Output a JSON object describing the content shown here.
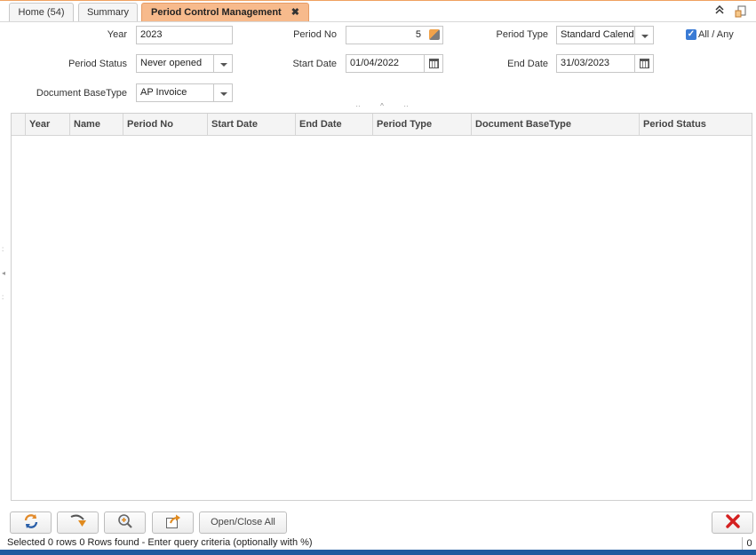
{
  "tabs": [
    {
      "label": "Home (54)"
    },
    {
      "label": "Summary"
    },
    {
      "label": "Period Control Management",
      "close": "✖"
    }
  ],
  "form": {
    "year": {
      "label": "Year",
      "value": "2023"
    },
    "period_no": {
      "label": "Period No",
      "value": "5"
    },
    "period_type": {
      "label": "Period Type",
      "value": "Standard Calend"
    },
    "all_any": {
      "label": "All / Any",
      "checked": true
    },
    "period_status": {
      "label": "Period Status",
      "value": "Never opened"
    },
    "start_date": {
      "label": "Start Date",
      "value": "01/04/2022"
    },
    "end_date": {
      "label": "End Date",
      "value": "31/03/2023"
    },
    "doc_base_type": {
      "label": "Document BaseType",
      "value": "AP Invoice"
    }
  },
  "grid": {
    "columns": [
      "Year",
      "Name",
      "Period No",
      "Start Date",
      "End Date",
      "Period Type",
      "Document BaseType",
      "Period Status"
    ],
    "rows": []
  },
  "toolbar": {
    "refresh_icon": "refresh-icon",
    "dropdown_icon": "down-arrow-icon",
    "zoom_icon": "zoom-icon",
    "export_icon": "export-icon",
    "open_close_label": "Open/Close All",
    "cancel_icon": "cancel-icon"
  },
  "status": {
    "text": "Selected 0 rows  0 Rows found - Enter query criteria (optionally with %)",
    "count": "0"
  },
  "colors": {
    "active_tab": "#f7ba8c",
    "accent": "#f0a160",
    "cancel_red": "#d42020",
    "taskbar": "#1e5a9e"
  }
}
